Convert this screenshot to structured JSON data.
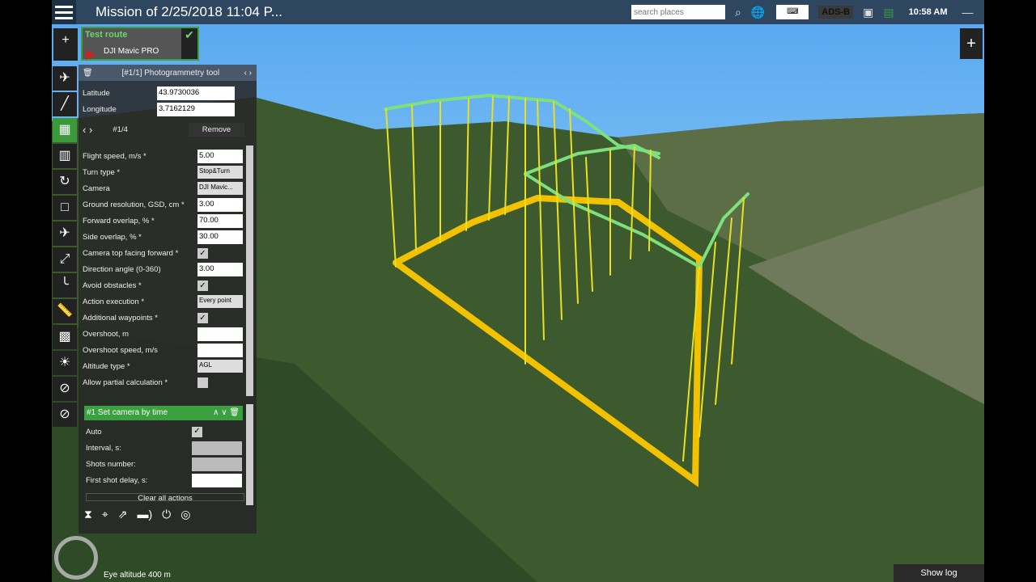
{
  "topbar": {
    "title": "Mission of 2/25/2018 11:04 P...",
    "search_placeholder": "search places",
    "adsb": "ADS-B",
    "clock": "10:58 AM"
  },
  "route": {
    "name": "Test route",
    "drone": "DJI Mavic PRO"
  },
  "tool": {
    "title": "[#1/1] Photogrammetry tool",
    "latitude_label": "Latitude",
    "latitude": "43.9730036",
    "longitude_label": "Longitude",
    "longitude": "3.7162129",
    "point": "#1/4",
    "remove": "Remove"
  },
  "fields": [
    {
      "label": "Flight speed, m/s *",
      "value": "5.00",
      "type": "input"
    },
    {
      "label": "Turn type *",
      "value": "Stop&Turn",
      "type": "select"
    },
    {
      "label": "Camera",
      "value": "DJI Mavic...",
      "type": "select"
    },
    {
      "label": "Ground resolution, GSD, cm *",
      "value": "3.00",
      "type": "input"
    },
    {
      "label": "Forward overlap, % *",
      "value": "70.00",
      "type": "input"
    },
    {
      "label": "Side overlap, % *",
      "value": "30.00",
      "type": "input"
    },
    {
      "label": "Camera top facing forward *",
      "checked": true,
      "type": "check"
    },
    {
      "label": "Direction angle (0-360)",
      "value": "3.00",
      "type": "input"
    },
    {
      "label": "Avoid obstacles *",
      "checked": true,
      "type": "check"
    },
    {
      "label": "Action execution *",
      "value": "Every point",
      "type": "select"
    },
    {
      "label": "Additional waypoints *",
      "checked": true,
      "type": "check"
    },
    {
      "label": "Overshoot, m",
      "value": "",
      "type": "input"
    },
    {
      "label": "Overshoot speed, m/s",
      "value": "",
      "type": "input"
    },
    {
      "label": "Altitude type *",
      "value": "AGL",
      "type": "select"
    },
    {
      "label": "Allow partial calculation *",
      "checked": false,
      "type": "check"
    }
  ],
  "action": {
    "title": "#1 Set camera by time",
    "auto_label": "Auto",
    "auto": true,
    "interval_label": "Interval, s:",
    "shots_label": "Shots number:",
    "delay_label": "First shot delay, s:",
    "clear": "Clear all actions"
  },
  "footer": {
    "eye_altitude": "Eye altitude 400 m",
    "show_log": "Show log"
  }
}
